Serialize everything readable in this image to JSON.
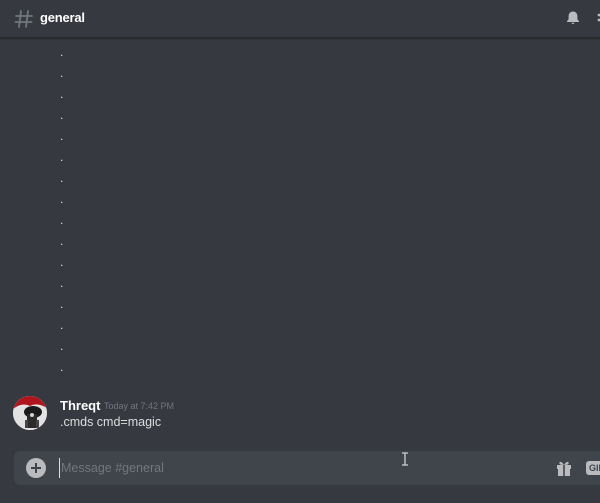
{
  "header": {
    "channel_name": "general",
    "icons": [
      "hash-icon",
      "bell-icon",
      "overflow-icon"
    ]
  },
  "messages": {
    "dots": [
      ".",
      ".",
      ".",
      ".",
      ".",
      ".",
      ".",
      ".",
      ".",
      ".",
      ".",
      ".",
      ".",
      ".",
      ".",
      "."
    ],
    "message": {
      "username": "Threqt",
      "timestamp": "Today at 7:42 PM",
      "text": ".cmds cmd=magic"
    }
  },
  "composer": {
    "placeholder": "Message #general",
    "value": "",
    "gif_label": "GIF",
    "icons": [
      "plus-icon",
      "gift-icon"
    ]
  },
  "colors": {
    "background": "#36393f",
    "composer": "#40444b",
    "text": "#dcddde",
    "muted": "#72767d",
    "username": "#ffffff"
  }
}
